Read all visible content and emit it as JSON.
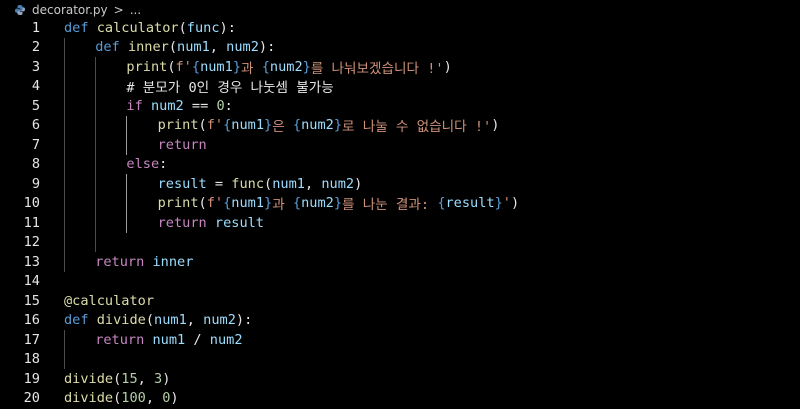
{
  "breadcrumb": {
    "file_name": "decorator.py",
    "separator": ">",
    "more": "..."
  },
  "lines": [
    {
      "n": "1",
      "indent": 0,
      "tokens": [
        {
          "t": "def",
          "c": "kw"
        },
        {
          "t": " "
        },
        {
          "t": "calculator",
          "c": "fn"
        },
        {
          "t": "(",
          "c": "plain"
        },
        {
          "t": "func",
          "c": "var"
        },
        {
          "t": "):",
          "c": "plain"
        }
      ]
    },
    {
      "n": "2",
      "indent": 1,
      "tokens": [
        {
          "t": "def",
          "c": "kw"
        },
        {
          "t": " "
        },
        {
          "t": "inner",
          "c": "fn"
        },
        {
          "t": "(",
          "c": "plain"
        },
        {
          "t": "num1",
          "c": "var"
        },
        {
          "t": ", ",
          "c": "plain"
        },
        {
          "t": "num2",
          "c": "var"
        },
        {
          "t": "):",
          "c": "plain"
        }
      ]
    },
    {
      "n": "3",
      "indent": 2,
      "tokens": [
        {
          "t": "print",
          "c": "fn"
        },
        {
          "t": "(",
          "c": "plain"
        },
        {
          "t": "f'",
          "c": "str"
        },
        {
          "t": "{",
          "c": "kw"
        },
        {
          "t": "num1",
          "c": "var"
        },
        {
          "t": "}",
          "c": "kw"
        },
        {
          "t": "과 ",
          "c": "str"
        },
        {
          "t": "{",
          "c": "kw"
        },
        {
          "t": "num2",
          "c": "var"
        },
        {
          "t": "}",
          "c": "kw"
        },
        {
          "t": "를 나눠보겠습니다 !'",
          "c": "str"
        },
        {
          "t": ")",
          "c": "plain"
        }
      ]
    },
    {
      "n": "4",
      "indent": 2,
      "tokens": [
        {
          "t": "# 분모가 0인 경우 나눗셈 불가능",
          "c": "cmt"
        }
      ]
    },
    {
      "n": "5",
      "indent": 2,
      "tokens": [
        {
          "t": "if",
          "c": "kw2"
        },
        {
          "t": " "
        },
        {
          "t": "num2",
          "c": "var"
        },
        {
          "t": " == ",
          "c": "plain"
        },
        {
          "t": "0",
          "c": "num"
        },
        {
          "t": ":",
          "c": "plain"
        }
      ]
    },
    {
      "n": "6",
      "indent": 3,
      "tokens": [
        {
          "t": "print",
          "c": "fn"
        },
        {
          "t": "(",
          "c": "plain"
        },
        {
          "t": "f'",
          "c": "str"
        },
        {
          "t": "{",
          "c": "kw"
        },
        {
          "t": "num1",
          "c": "var"
        },
        {
          "t": "}",
          "c": "kw"
        },
        {
          "t": "은 ",
          "c": "str"
        },
        {
          "t": "{",
          "c": "kw"
        },
        {
          "t": "num2",
          "c": "var"
        },
        {
          "t": "}",
          "c": "kw"
        },
        {
          "t": "로 나눌 수 없습니다 !'",
          "c": "str"
        },
        {
          "t": ")",
          "c": "plain"
        }
      ]
    },
    {
      "n": "7",
      "indent": 3,
      "tokens": [
        {
          "t": "return",
          "c": "kw2"
        }
      ]
    },
    {
      "n": "8",
      "indent": 2,
      "tokens": [
        {
          "t": "else",
          "c": "kw2"
        },
        {
          "t": ":",
          "c": "plain"
        }
      ]
    },
    {
      "n": "9",
      "indent": 3,
      "tokens": [
        {
          "t": "result",
          "c": "var"
        },
        {
          "t": " = ",
          "c": "plain"
        },
        {
          "t": "func",
          "c": "fn"
        },
        {
          "t": "(",
          "c": "plain"
        },
        {
          "t": "num1",
          "c": "var"
        },
        {
          "t": ", ",
          "c": "plain"
        },
        {
          "t": "num2",
          "c": "var"
        },
        {
          "t": ")",
          "c": "plain"
        }
      ]
    },
    {
      "n": "10",
      "indent": 3,
      "tokens": [
        {
          "t": "print",
          "c": "fn"
        },
        {
          "t": "(",
          "c": "plain"
        },
        {
          "t": "f'",
          "c": "str"
        },
        {
          "t": "{",
          "c": "kw"
        },
        {
          "t": "num1",
          "c": "var"
        },
        {
          "t": "}",
          "c": "kw"
        },
        {
          "t": "과 ",
          "c": "str"
        },
        {
          "t": "{",
          "c": "kw"
        },
        {
          "t": "num2",
          "c": "var"
        },
        {
          "t": "}",
          "c": "kw"
        },
        {
          "t": "를 나눈 결과: ",
          "c": "str"
        },
        {
          "t": "{",
          "c": "kw"
        },
        {
          "t": "result",
          "c": "var"
        },
        {
          "t": "}",
          "c": "kw"
        },
        {
          "t": "'",
          "c": "str"
        },
        {
          "t": ")",
          "c": "plain"
        }
      ]
    },
    {
      "n": "11",
      "indent": 3,
      "tokens": [
        {
          "t": "return",
          "c": "kw2"
        },
        {
          "t": " "
        },
        {
          "t": "result",
          "c": "var"
        }
      ]
    },
    {
      "n": "12",
      "indent": 0,
      "tokens": []
    },
    {
      "n": "13",
      "indent": 1,
      "tokens": [
        {
          "t": "return",
          "c": "kw2"
        },
        {
          "t": " "
        },
        {
          "t": "inner",
          "c": "var"
        }
      ]
    },
    {
      "n": "14",
      "indent": 0,
      "tokens": []
    },
    {
      "n": "15",
      "indent": 0,
      "tokens": [
        {
          "t": "@calculator",
          "c": "dec"
        }
      ]
    },
    {
      "n": "16",
      "indent": 0,
      "tokens": [
        {
          "t": "def",
          "c": "kw"
        },
        {
          "t": " "
        },
        {
          "t": "divide",
          "c": "fn"
        },
        {
          "t": "(",
          "c": "plain"
        },
        {
          "t": "num1",
          "c": "var"
        },
        {
          "t": ", ",
          "c": "plain"
        },
        {
          "t": "num2",
          "c": "var"
        },
        {
          "t": "):",
          "c": "plain"
        }
      ]
    },
    {
      "n": "17",
      "indent": 1,
      "tokens": [
        {
          "t": "return",
          "c": "kw2"
        },
        {
          "t": " "
        },
        {
          "t": "num1",
          "c": "var"
        },
        {
          "t": " / ",
          "c": "plain"
        },
        {
          "t": "num2",
          "c": "var"
        }
      ]
    },
    {
      "n": "18",
      "indent": 0,
      "tokens": []
    },
    {
      "n": "19",
      "indent": 0,
      "tokens": [
        {
          "t": "divide",
          "c": "fn"
        },
        {
          "t": "(",
          "c": "plain"
        },
        {
          "t": "15",
          "c": "num"
        },
        {
          "t": ", ",
          "c": "plain"
        },
        {
          "t": "3",
          "c": "num"
        },
        {
          "t": ")",
          "c": "plain"
        }
      ]
    },
    {
      "n": "20",
      "indent": 0,
      "tokens": [
        {
          "t": "divide",
          "c": "fn"
        },
        {
          "t": "(",
          "c": "plain"
        },
        {
          "t": "100",
          "c": "num"
        },
        {
          "t": ", ",
          "c": "plain"
        },
        {
          "t": "0",
          "c": "num"
        },
        {
          "t": ")",
          "c": "plain"
        }
      ]
    }
  ]
}
